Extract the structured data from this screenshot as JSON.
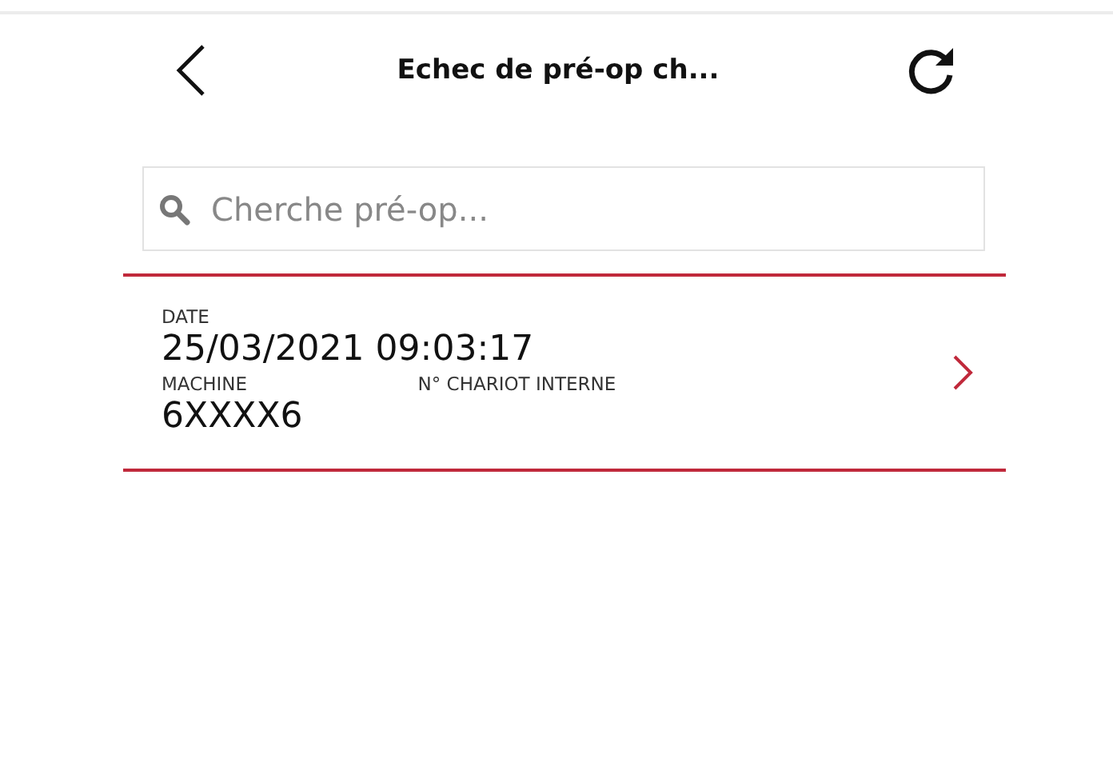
{
  "header": {
    "title": "Echec de pré-op ch..."
  },
  "search": {
    "placeholder": "Cherche pré-op..."
  },
  "records": [
    {
      "date_label": "DATE",
      "date": "25/03/2021 09:03:17",
      "machine_label": "MACHINE",
      "machine": "6XXXX6",
      "chariot_label": "N° CHARIOT INTERNE"
    }
  ]
}
